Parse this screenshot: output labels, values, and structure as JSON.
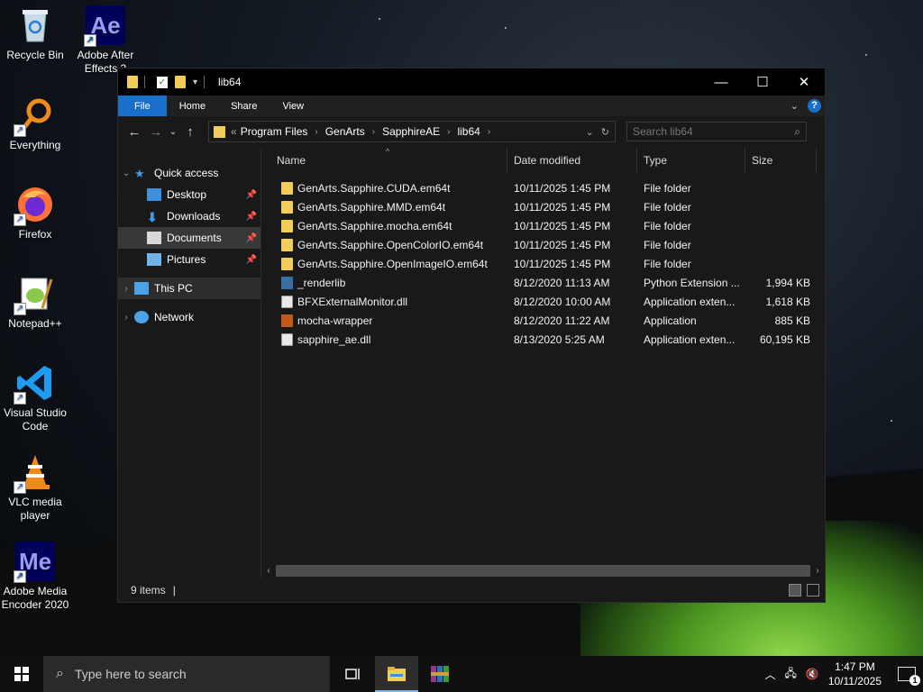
{
  "desktop": {
    "icons": [
      {
        "label": "Recycle Bin",
        "icon": "recycle-bin-icon"
      },
      {
        "label": "Adobe After Effects 2",
        "icon": "after-effects-icon"
      },
      {
        "label": "Everything",
        "icon": "everything-search-icon"
      },
      {
        "label": "Firefox",
        "icon": "firefox-icon"
      },
      {
        "label": "Notepad++",
        "icon": "notepadpp-icon"
      },
      {
        "label": "Visual Studio Code",
        "icon": "vscode-icon"
      },
      {
        "label": "VLC media player",
        "icon": "vlc-icon"
      },
      {
        "label": "Adobe Media Encoder 2020",
        "icon": "media-encoder-icon"
      }
    ],
    "ae_glyph": "Ae",
    "me_glyph": "Me"
  },
  "window": {
    "title": "lib64",
    "controls": {
      "minimize": "—",
      "maximize": "☐",
      "close": "✕"
    }
  },
  "ribbon": {
    "tabs": [
      "File",
      "Home",
      "Share",
      "View"
    ],
    "help": "?"
  },
  "address": {
    "overflow": "«",
    "crumbs": [
      "Program Files",
      "GenArts",
      "SapphireAE",
      "lib64"
    ]
  },
  "search": {
    "placeholder": "Search lib64"
  },
  "nav": {
    "items": [
      {
        "label": "Quick access"
      },
      {
        "label": "Desktop"
      },
      {
        "label": "Downloads"
      },
      {
        "label": "Documents"
      },
      {
        "label": "Pictures"
      },
      {
        "label": "This PC"
      },
      {
        "label": "Network"
      }
    ]
  },
  "columns": {
    "name": "Name",
    "date": "Date modified",
    "type": "Type",
    "size": "Size"
  },
  "files": [
    {
      "name": "GenArts.Sapphire.CUDA.em64t",
      "date": "10/11/2025 1:45 PM",
      "type": "File folder",
      "size": "",
      "kind": "folder"
    },
    {
      "name": "GenArts.Sapphire.MMD.em64t",
      "date": "10/11/2025 1:45 PM",
      "type": "File folder",
      "size": "",
      "kind": "folder"
    },
    {
      "name": "GenArts.Sapphire.mocha.em64t",
      "date": "10/11/2025 1:45 PM",
      "type": "File folder",
      "size": "",
      "kind": "folder"
    },
    {
      "name": "GenArts.Sapphire.OpenColorIO.em64t",
      "date": "10/11/2025 1:45 PM",
      "type": "File folder",
      "size": "",
      "kind": "folder"
    },
    {
      "name": "GenArts.Sapphire.OpenImageIO.em64t",
      "date": "10/11/2025 1:45 PM",
      "type": "File folder",
      "size": "",
      "kind": "folder"
    },
    {
      "name": "_renderlib",
      "date": "8/12/2020 11:13 AM",
      "type": "Python Extension ...",
      "size": "1,994 KB",
      "kind": "python"
    },
    {
      "name": "BFXExternalMonitor.dll",
      "date": "8/12/2020 10:00 AM",
      "type": "Application exten...",
      "size": "1,618 KB",
      "kind": "dll"
    },
    {
      "name": "mocha-wrapper",
      "date": "8/12/2020 11:22 AM",
      "type": "Application",
      "size": "885 KB",
      "kind": "app"
    },
    {
      "name": "sapphire_ae.dll",
      "date": "8/13/2020 5:25 AM",
      "type": "Application exten...",
      "size": "60,195 KB",
      "kind": "dll"
    }
  ],
  "status": {
    "count": "9 items",
    "cursor": "|"
  },
  "taskbar": {
    "search_placeholder": "Type here to search",
    "time": "1:47 PM",
    "date": "10/11/2025",
    "notifications": "1"
  }
}
